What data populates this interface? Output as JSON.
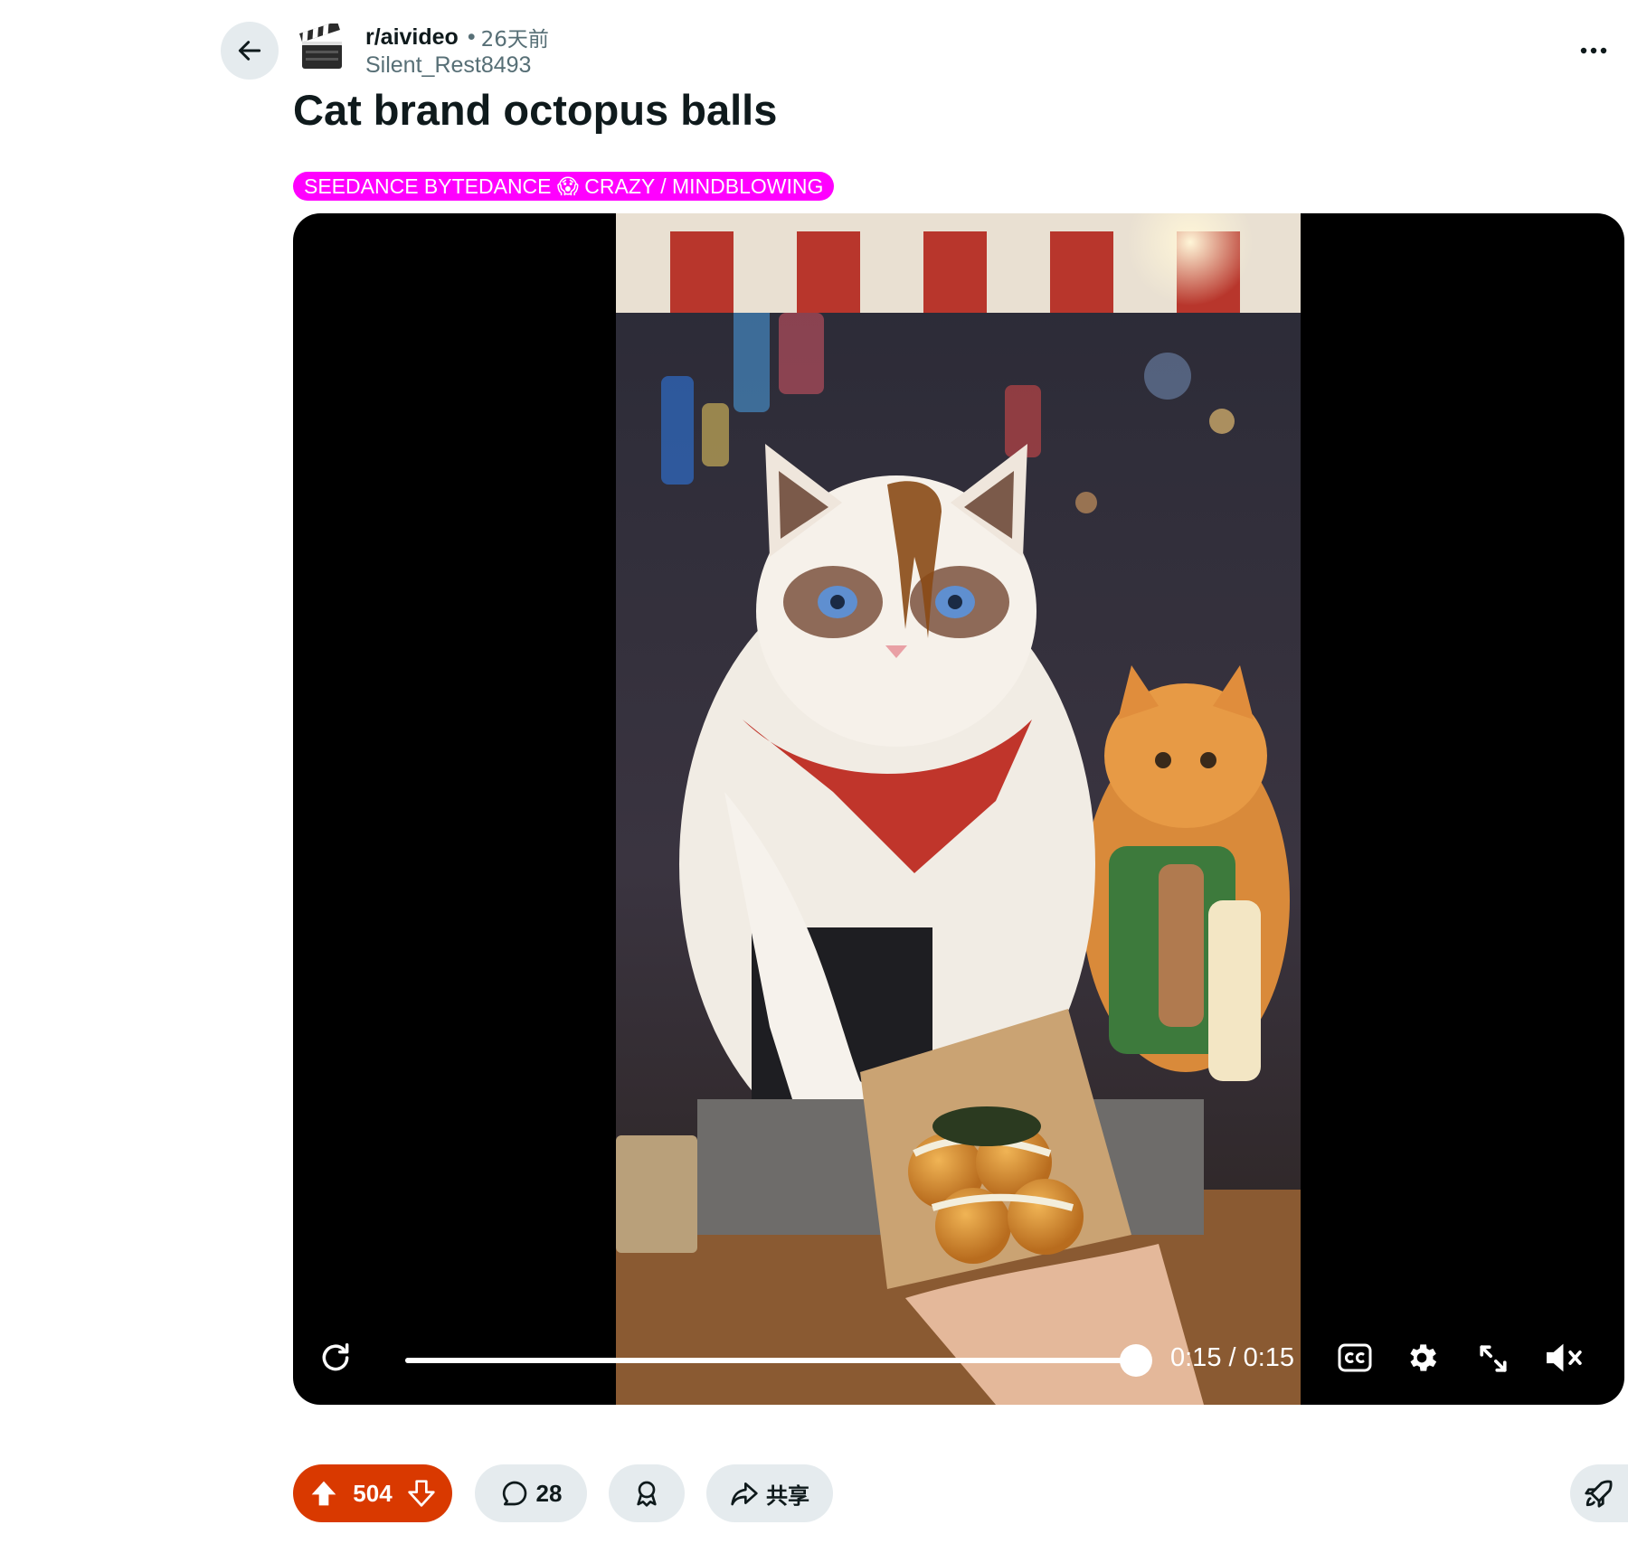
{
  "post": {
    "subreddit": "r/aivideo",
    "separator": "•",
    "time_ago": "26天前",
    "author": "Silent_Rest8493",
    "title": "Cat brand octopus balls",
    "flair": "SEEDANCE BYTEDANCE 😱 CRAZY / MINDBLOWING"
  },
  "video": {
    "time_display": "0:15 / 0:15",
    "progress": 1.0,
    "controls": [
      "replay-icon",
      "captions-icon",
      "settings-icon",
      "fullscreen-icon",
      "muted-icon"
    ]
  },
  "actions": {
    "upvotes": "504",
    "comments": "28",
    "share_label": "共享"
  },
  "colors": {
    "upvote_active": "#d93900",
    "flair_bg": "#ff00ff",
    "pill_bg": "#e5ebee"
  }
}
